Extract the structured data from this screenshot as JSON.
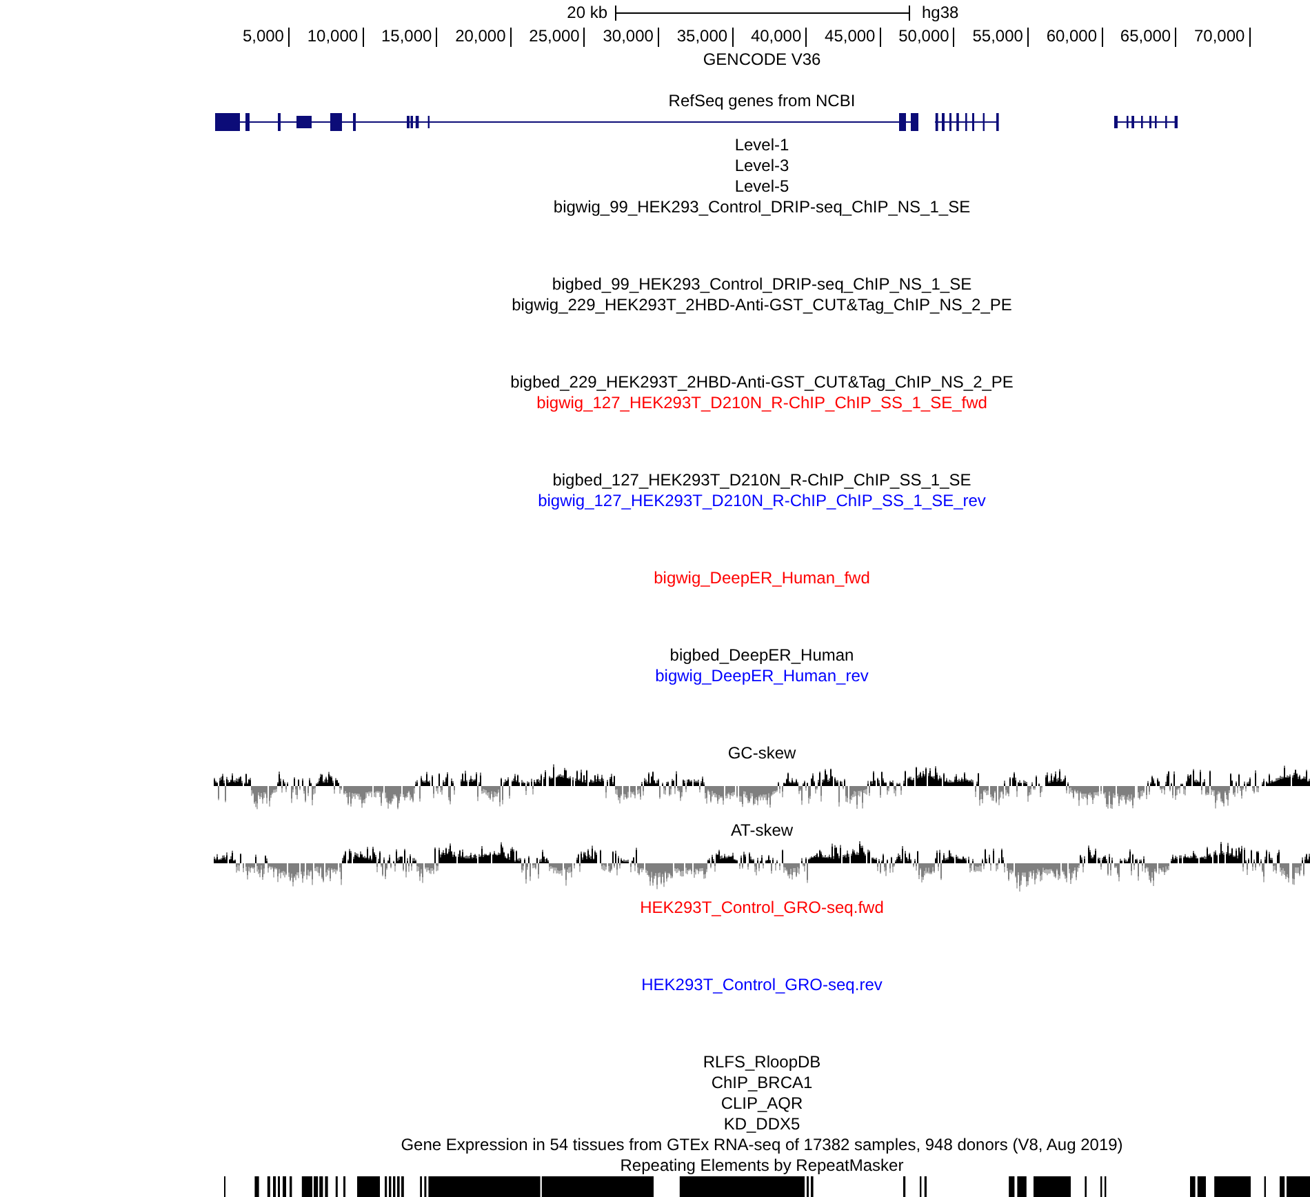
{
  "scale_bar": {
    "label": "20 kb",
    "assembly": "hg38"
  },
  "ruler": {
    "ticks": [
      "5,000",
      "10,000",
      "15,000",
      "20,000",
      "25,000",
      "30,000",
      "35,000",
      "40,000",
      "45,000",
      "50,000",
      "55,000",
      "60,000",
      "65,000",
      "70,000"
    ]
  },
  "tracks": [
    {
      "kind": "dense",
      "title": "GENCODE V36",
      "color": "#000000"
    },
    {
      "kind": "genes",
      "title": "RefSeq genes from NCBI",
      "color": "#000000"
    },
    {
      "kind": "bed",
      "title": "Level-1",
      "color": "#000000"
    },
    {
      "kind": "bed",
      "title": "Level-3",
      "color": "#000000"
    },
    {
      "kind": "bed",
      "title": "Level-5",
      "color": "#000000"
    },
    {
      "kind": "signal",
      "title": "bigwig_99_HEK293_Control_DRIP-seq_ChIP_NS_1_SE",
      "color": "#000000"
    },
    {
      "kind": "bed",
      "title": "bigbed_99_HEK293_Control_DRIP-seq_ChIP_NS_1_SE",
      "color": "#000000"
    },
    {
      "kind": "signal",
      "title": "bigwig_229_HEK293T_2HBD-Anti-GST_CUT&Tag_ChIP_NS_2_PE",
      "color": "#000000"
    },
    {
      "kind": "bed",
      "title": "bigbed_229_HEK293T_2HBD-Anti-GST_CUT&Tag_ChIP_NS_2_PE",
      "color": "#000000"
    },
    {
      "kind": "signal",
      "title": "bigwig_127_HEK293T_D210N_R-ChIP_ChIP_SS_1_SE_fwd",
      "color": "#ff0000"
    },
    {
      "kind": "bed",
      "title": "bigbed_127_HEK293T_D210N_R-ChIP_ChIP_SS_1_SE",
      "color": "#000000"
    },
    {
      "kind": "signal",
      "title": "bigwig_127_HEK293T_D210N_R-ChIP_ChIP_SS_1_SE_rev",
      "color": "#0000ff"
    },
    {
      "kind": "signal",
      "title": "bigwig_DeepER_Human_fwd",
      "color": "#ff0000"
    },
    {
      "kind": "bed",
      "title": "bigbed_DeepER_Human",
      "color": "#000000"
    },
    {
      "kind": "signal",
      "title": "bigwig_DeepER_Human_rev",
      "color": "#0000ff"
    },
    {
      "kind": "skew",
      "title": "GC-skew",
      "color": "#000000"
    },
    {
      "kind": "skew",
      "title": "AT-skew",
      "color": "#000000"
    },
    {
      "kind": "signal",
      "title": "HEK293T_Control_GRO-seq.fwd",
      "color": "#ff0000"
    },
    {
      "kind": "signal",
      "title": "HEK293T_Control_GRO-seq.rev",
      "color": "#0000ff"
    },
    {
      "kind": "bed",
      "title": "RLFS_RloopDB",
      "color": "#000000"
    },
    {
      "kind": "bed",
      "title": "ChIP_BRCA1",
      "color": "#000000"
    },
    {
      "kind": "bed",
      "title": "CLIP_AQR",
      "color": "#000000"
    },
    {
      "kind": "bed",
      "title": "KD_DDX5",
      "color": "#000000"
    },
    {
      "kind": "bed",
      "title": "Gene Expression in 54 tissues from GTEx RNA-seq of 17382 samples, 948 donors (V8, Aug 2019)",
      "color": "#000000"
    },
    {
      "kind": "repeats",
      "title": "Repeating Elements by RepeatMasker",
      "color": "#000000"
    }
  ]
}
